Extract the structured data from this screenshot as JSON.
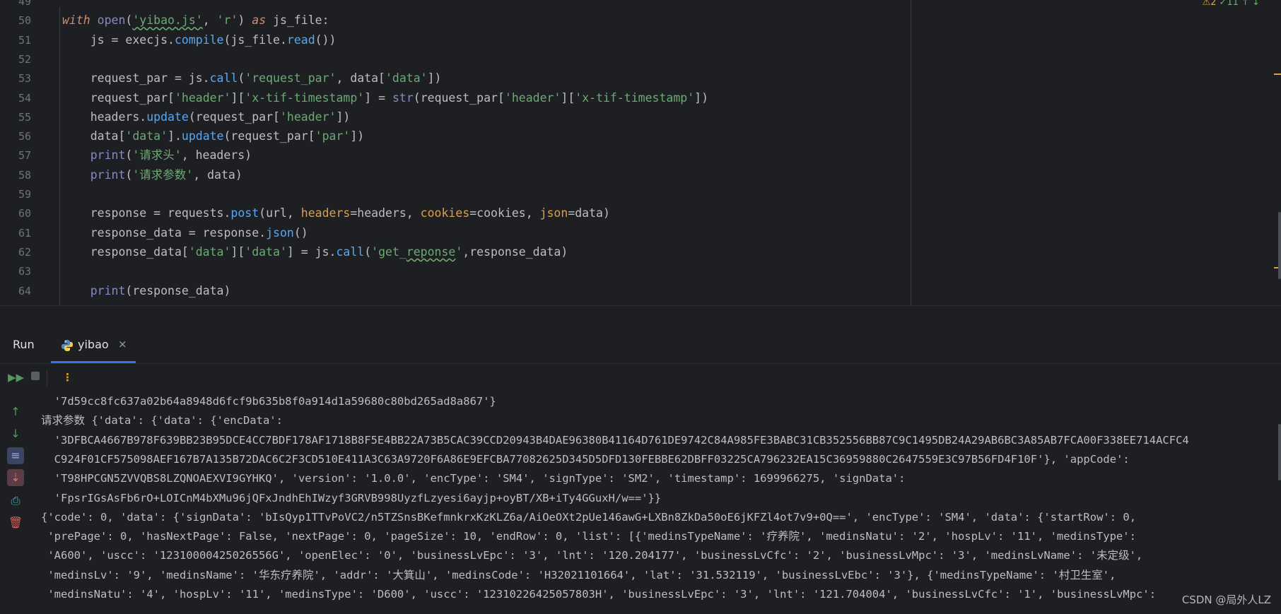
{
  "editor": {
    "lines": [
      {
        "n": "49",
        "segs": []
      },
      {
        "n": "50",
        "segs": [
          [
            "kw",
            "with "
          ],
          [
            "bi",
            "open"
          ],
          [
            "p",
            "("
          ],
          [
            "str ul",
            "'yibao.js'"
          ],
          [
            "p",
            ", "
          ],
          [
            "str",
            "'r'"
          ],
          [
            "p",
            ") "
          ],
          [
            "kw",
            "as"
          ],
          [
            "p",
            " js_file:"
          ]
        ]
      },
      {
        "n": "51",
        "segs": [
          [
            "p",
            "    js = execjs."
          ],
          [
            "fn",
            "compile"
          ],
          [
            "p",
            "(js_file."
          ],
          [
            "fn",
            "read"
          ],
          [
            "p",
            "())"
          ]
        ]
      },
      {
        "n": "52",
        "segs": []
      },
      {
        "n": "53",
        "segs": [
          [
            "p",
            "    request_par = js."
          ],
          [
            "fn",
            "call"
          ],
          [
            "p",
            "("
          ],
          [
            "str",
            "'request_par'"
          ],
          [
            "p",
            ", data["
          ],
          [
            "str",
            "'data'"
          ],
          [
            "p",
            "])"
          ]
        ]
      },
      {
        "n": "54",
        "segs": [
          [
            "p",
            "    request_par["
          ],
          [
            "str",
            "'header'"
          ],
          [
            "p",
            "]["
          ],
          [
            "str",
            "'x-tif-timestamp'"
          ],
          [
            "p",
            "] = "
          ],
          [
            "bi",
            "str"
          ],
          [
            "p",
            "(request_par["
          ],
          [
            "str",
            "'header'"
          ],
          [
            "p",
            "]["
          ],
          [
            "str",
            "'x-tif-timestamp'"
          ],
          [
            "p",
            "])"
          ]
        ]
      },
      {
        "n": "55",
        "segs": [
          [
            "p",
            "    headers."
          ],
          [
            "fn",
            "update"
          ],
          [
            "p",
            "(request_par["
          ],
          [
            "str",
            "'header'"
          ],
          [
            "p",
            "])"
          ]
        ]
      },
      {
        "n": "56",
        "segs": [
          [
            "p",
            "    data["
          ],
          [
            "str",
            "'data'"
          ],
          [
            "p",
            "]."
          ],
          [
            "fn",
            "update"
          ],
          [
            "p",
            "(request_par["
          ],
          [
            "str",
            "'par'"
          ],
          [
            "p",
            "])"
          ]
        ]
      },
      {
        "n": "57",
        "segs": [
          [
            "p",
            "    "
          ],
          [
            "bi",
            "print"
          ],
          [
            "p",
            "("
          ],
          [
            "str",
            "'请求头'"
          ],
          [
            "p",
            ", headers)"
          ]
        ]
      },
      {
        "n": "58",
        "segs": [
          [
            "p",
            "    "
          ],
          [
            "bi",
            "print"
          ],
          [
            "p",
            "("
          ],
          [
            "str",
            "'请求参数'"
          ],
          [
            "p",
            ", data)"
          ]
        ]
      },
      {
        "n": "59",
        "segs": []
      },
      {
        "n": "60",
        "segs": [
          [
            "p",
            "    response = requests."
          ],
          [
            "fn",
            "post"
          ],
          [
            "p",
            "(url, "
          ],
          [
            "par",
            "headers"
          ],
          [
            "p",
            "=headers, "
          ],
          [
            "par",
            "cookies"
          ],
          [
            "p",
            "=cookies, "
          ],
          [
            "par",
            "json"
          ],
          [
            "p",
            "=data)"
          ]
        ]
      },
      {
        "n": "61",
        "segs": [
          [
            "p",
            "    response_data = response."
          ],
          [
            "fn",
            "json"
          ],
          [
            "p",
            "()"
          ]
        ]
      },
      {
        "n": "62",
        "segs": [
          [
            "p",
            "    response_data["
          ],
          [
            "str",
            "'data'"
          ],
          [
            "p",
            "]["
          ],
          [
            "str",
            "'data'"
          ],
          [
            "p",
            "] = js."
          ],
          [
            "fn",
            "call"
          ],
          [
            "p",
            "("
          ],
          [
            "str",
            "'get_"
          ],
          [
            "str ul",
            "reponse"
          ],
          [
            "str",
            "'"
          ],
          [
            "p",
            ",response_data)"
          ]
        ]
      },
      {
        "n": "63",
        "segs": []
      },
      {
        "n": "64",
        "segs": [
          [
            "p",
            "    "
          ],
          [
            "bi",
            "print"
          ],
          [
            "p",
            "(response_data)"
          ]
        ]
      }
    ],
    "badge_warn": "⚠2",
    "badge_ok": "✓11 ↑ ↓"
  },
  "run": {
    "title": "Run",
    "tab_label": "yibao",
    "close_glyph": "×"
  },
  "console": {
    "lines": [
      "  '7d59cc8fc637a02b64a8948d6fcf9b635b8f0a914d1a59680c80bd265ad8a867'}",
      "请求参数 {'data': {'data': {'encData':",
      "  '3DFBCA4667B978F639BB23B95DCE4CC7BDF178AF1718B8F5E4BB22A73B5CAC39CCD20943B4DAE96380B41164D761DE9742C84A985FE3BABC31CB352556BB87C9C1495DB24A29AB6BC3A85AB7FCA00F338EE714ACFC4",
      "  C924F01CF575098AEF167B7A135B72DAC6C2F3CD510E411A3C63A9720F6A86E9EFCBA77082625D345D5DFD130FEBBE62DBFF03225CA796232EA15C36959880C2647559E3C97B56FD4F10F'}, 'appCode':",
      "  'T98HPCGN5ZVVQBS8LZQNOAEXVI9GYHKQ', 'version': '1.0.0', 'encType': 'SM4', 'signType': 'SM2', 'timestamp': 1699966275, 'signData':",
      "  'FpsrIGsAsFb6rO+LOICnM4bXMu96jQFxJndhEhIWzyf3GRVB998UyzfLzyesi6ayjp+oyBT/XB+iTy4GGuxH/w=='}}",
      "{'code': 0, 'data': {'signData': 'bIsQyp1TTvPoVC2/n5TZSnsBKefmnkrxKzKLZ6a/AiOeOXt2pUe146awG+LXBn8ZkDa50oE6jKFZl4ot7v9+0Q==', 'encType': 'SM4', 'data': {'startRow': 0,",
      " 'prePage': 0, 'hasNextPage': False, 'nextPage': 0, 'pageSize': 10, 'endRow': 0, 'list': [{'medinsTypeName': '疗养院', 'medinsNatu': '2', 'hospLv': '11', 'medinsType':",
      " 'A600', 'uscc': '12310000425026556G', 'openElec': '0', 'businessLvEpc': '3', 'lnt': '120.204177', 'businessLvCfc': '2', 'businessLvMpc': '3', 'medinsLvName': '未定级',",
      " 'medinsLv': '9', 'medinsName': '华东疗养院', 'addr': '大箕山', 'medinsCode': 'H32021101664', 'lat': '31.532119', 'businessLvEbc': '3'}, {'medinsTypeName': '村卫生室',",
      " 'medinsNatu': '4', 'hospLv': '11', 'medinsType': 'D600', 'uscc': '12310226425057803H', 'businessLvEpc': '3', 'lnt': '121.704004', 'businessLvCfc': '1', 'businessLvMpc':"
    ]
  },
  "watermark": "CSDN @局外人LZ"
}
